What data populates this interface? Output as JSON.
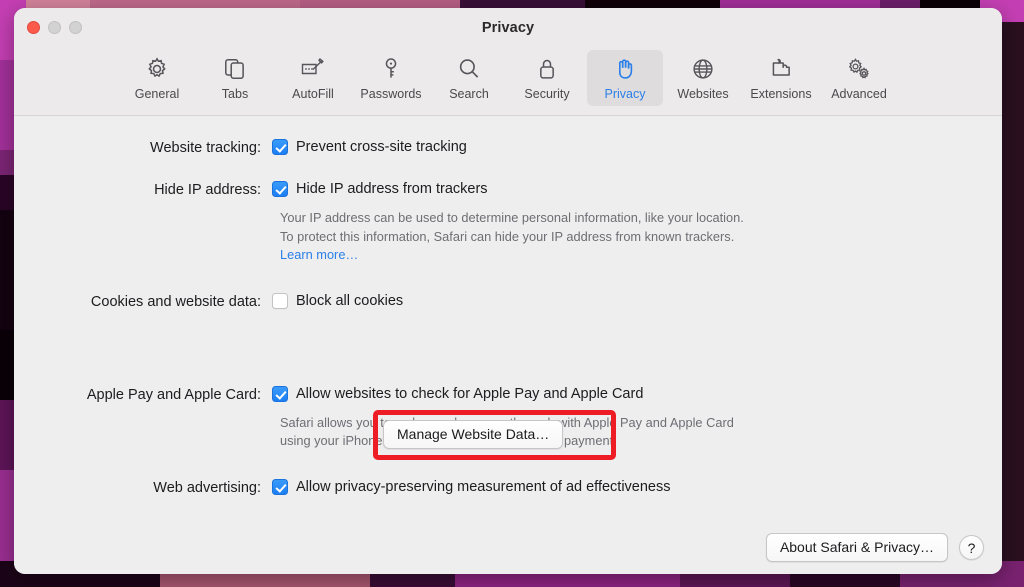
{
  "window": {
    "title": "Privacy",
    "traffic_lights": {
      "close": "close",
      "minimize": "minimize",
      "maximize": "maximize"
    }
  },
  "toolbar": {
    "items": [
      {
        "label": "General",
        "icon": "gear-icon",
        "selected": false
      },
      {
        "label": "Tabs",
        "icon": "tabs-icon",
        "selected": false
      },
      {
        "label": "AutoFill",
        "icon": "autofill-icon",
        "selected": false
      },
      {
        "label": "Passwords",
        "icon": "key-icon",
        "selected": false
      },
      {
        "label": "Search",
        "icon": "magnifier-icon",
        "selected": false
      },
      {
        "label": "Security",
        "icon": "lock-icon",
        "selected": false
      },
      {
        "label": "Privacy",
        "icon": "hand-icon",
        "selected": true
      },
      {
        "label": "Websites",
        "icon": "globe-icon",
        "selected": false
      },
      {
        "label": "Extensions",
        "icon": "puzzle-icon",
        "selected": false
      },
      {
        "label": "Advanced",
        "icon": "gears-icon",
        "selected": false
      }
    ]
  },
  "settings": {
    "website_tracking": {
      "label": "Website tracking:",
      "checkbox_label": "Prevent cross-site tracking",
      "checked": true
    },
    "hide_ip": {
      "label": "Hide IP address:",
      "checkbox_label": "Hide IP address from trackers",
      "checked": true,
      "description": "Your IP address can be used to determine personal information, like your location. To protect this information, Safari can hide your IP address from known trackers. ",
      "link_label": "Learn more…"
    },
    "cookies": {
      "label": "Cookies and website data:",
      "checkbox_label": "Block all cookies",
      "checked": false,
      "manage_button_label": "Manage Website Data…"
    },
    "apple_pay": {
      "label": "Apple Pay and Apple Card:",
      "checkbox_label": "Allow websites to check for Apple Pay and Apple Card",
      "checked": true,
      "description": "Safari allows you to make purchases on the web with Apple Pay and Apple Card using your iPhone or Apple Watch to confirm your payment."
    },
    "web_advertising": {
      "label": "Web advertising:",
      "checkbox_label": "Allow privacy-preserving measurement of ad effectiveness",
      "checked": true
    }
  },
  "footer": {
    "about_button_label": "About Safari & Privacy…",
    "help_button_label": "?"
  },
  "colors": {
    "accent_blue": "#2b7fe8",
    "checkbox_blue": "#1b7ef3",
    "highlight_red": "#ee1c25",
    "window_bg": "#eeeeef",
    "toolbar_bg": "#eceaeb",
    "secondary_text": "#6e6e73"
  }
}
